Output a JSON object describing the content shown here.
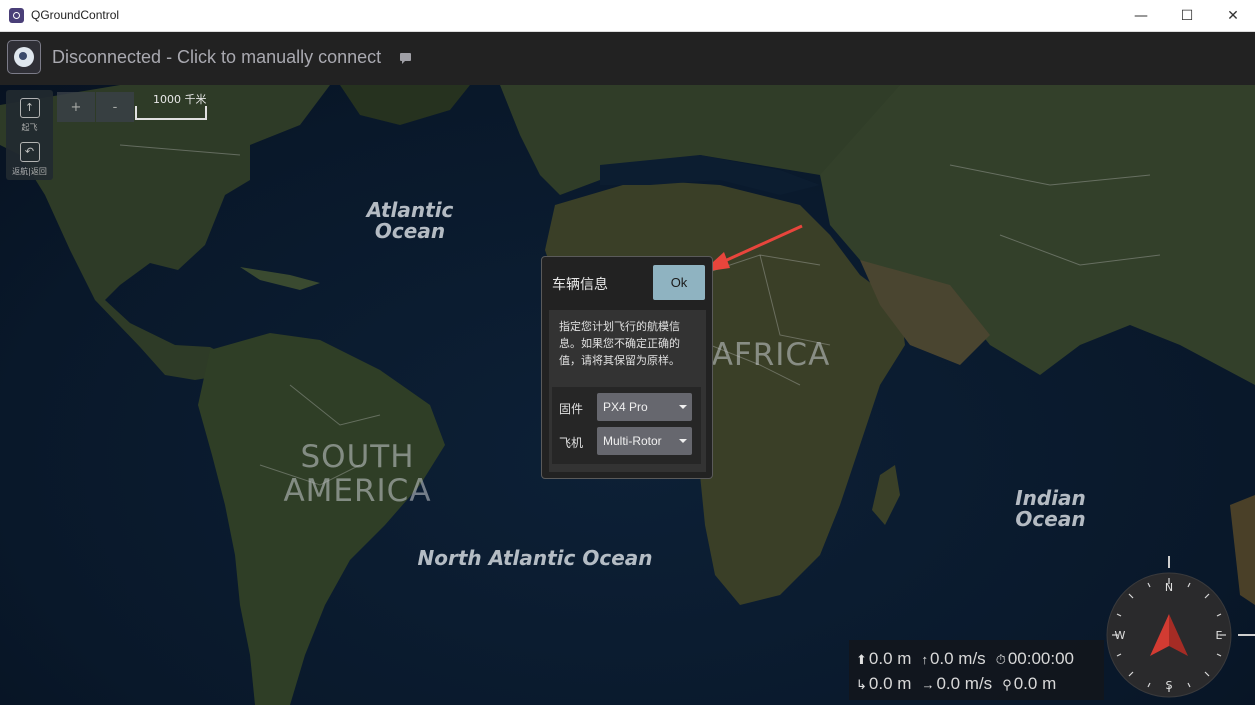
{
  "window": {
    "title": "QGroundControl",
    "controls": {
      "minimize": "—",
      "maximize": "☐",
      "close": "✕"
    }
  },
  "toolbar": {
    "status_text": "Disconnected - Click to manually connect",
    "logo_icon": "qgc-logo-icon",
    "message_icon": "message-icon"
  },
  "toolstrip": {
    "items": [
      {
        "label": "起飞",
        "icon": "takeoff-icon"
      },
      {
        "label": "返航|返回",
        "icon": "return-icon"
      }
    ]
  },
  "map": {
    "zoom_in": "+",
    "zoom_out": "-",
    "scale": "1000 千米",
    "labels": {
      "atlantic": "Atlantic\nOcean",
      "north_atlantic": "North Atlantic Ocean",
      "indian": "Indian\nOcean",
      "africa": "AFRICA",
      "south_america": "SOUTH\nAMERICA"
    }
  },
  "dialog": {
    "title": "车辆信息",
    "ok_label": "Ok",
    "description": "指定您计划飞行的航模信息。如果您不确定正确的值，请将其保留为原样。",
    "firmware_label": "固件",
    "firmware_value": "PX4 Pro",
    "vehicle_label": "飞机",
    "vehicle_value": "Multi-Rotor"
  },
  "telemetry": {
    "altitude": "0.0 m",
    "vertical_speed": "0.0 m/s",
    "flight_time": "00:00:00",
    "distance": "0.0 m",
    "horizontal_speed": "0.0 m/s",
    "distance_home": "0.0 m"
  },
  "compass": {
    "n": "N",
    "e": "E",
    "s": "S",
    "w": "W"
  },
  "colors": {
    "accent": "#8fb3c1",
    "arrow": "#e8453c",
    "toolbar": "#222222"
  }
}
